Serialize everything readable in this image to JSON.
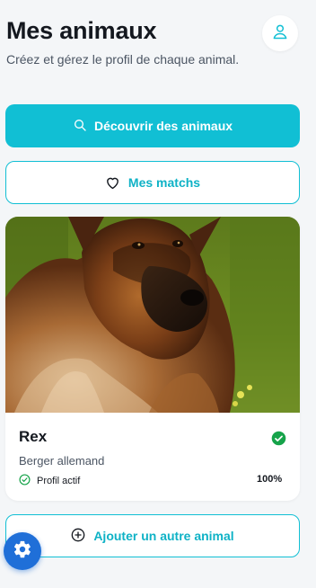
{
  "header": {
    "title": "Mes animaux",
    "subtitle": "Créez et gérez le profil de chaque animal."
  },
  "actions": {
    "discover_label": "Découvrir des animaux",
    "matches_label": "Mes matchs",
    "add_label": "Ajouter un autre animal"
  },
  "pet_card": {
    "name": "Rex",
    "breed": "Berger allemand",
    "status": "Profil actif",
    "completion": "100%"
  },
  "icons": {
    "profile": "user-icon",
    "discover": "search-icon",
    "matches": "heart-icon",
    "verified": "check-circle-icon",
    "status": "check-circle-outline-icon",
    "add": "plus-circle-icon",
    "settings": "gear-icon"
  },
  "colors": {
    "accent": "#11bfd4",
    "success": "#16a34a",
    "fab": "#1f6fd8",
    "background": "#f4f6f8"
  }
}
